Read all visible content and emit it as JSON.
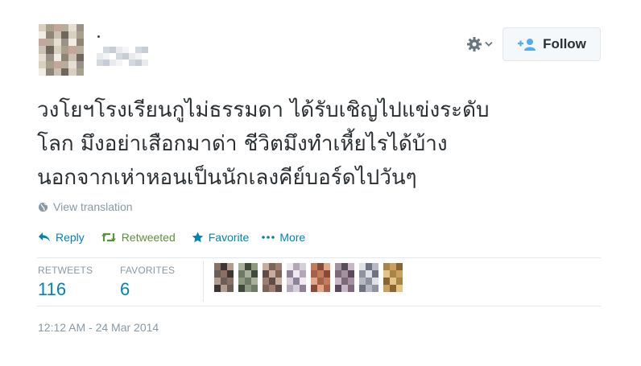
{
  "colors": {
    "link": "#0084b4",
    "retweet": "#5c913b",
    "muted": "#8899a6",
    "text": "#292f33",
    "border": "#e1e8ed",
    "button_bg": "#f5f8fa"
  },
  "header": {
    "settings_icon": "gear-icon",
    "follow_icon": "add-user-icon",
    "follow_label": "Follow"
  },
  "tweet": {
    "text": "วงโยฯโรงเรียนกูไม่ธรรมดา ได้รับเชิญไปแข่งระดับ\nโลก มึงอย่าเสือกมาด่า ชีวิตมึงทำเหี้ยไรได้บ้าง\nนอกจากเห่าหอนเป็นนักเลงคีย์บอร์ดไปวันๆ",
    "translate_icon": "globe-icon",
    "translate_label": "View translation"
  },
  "actions": {
    "reply_icon": "reply-icon",
    "reply": "Reply",
    "retweet_icon": "retweet-icon",
    "retweet": "Retweeted",
    "favorite_icon": "star-icon",
    "favorite": "Favorite",
    "more_icon": "more-dots-icon",
    "more": "More"
  },
  "stats": {
    "retweets_label": "RETWEETS",
    "retweets_value": "116",
    "favorites_label": "FAVORITES",
    "favorites_value": "6"
  },
  "timestamp": "12:12 AM - 24 Mar 2014"
}
